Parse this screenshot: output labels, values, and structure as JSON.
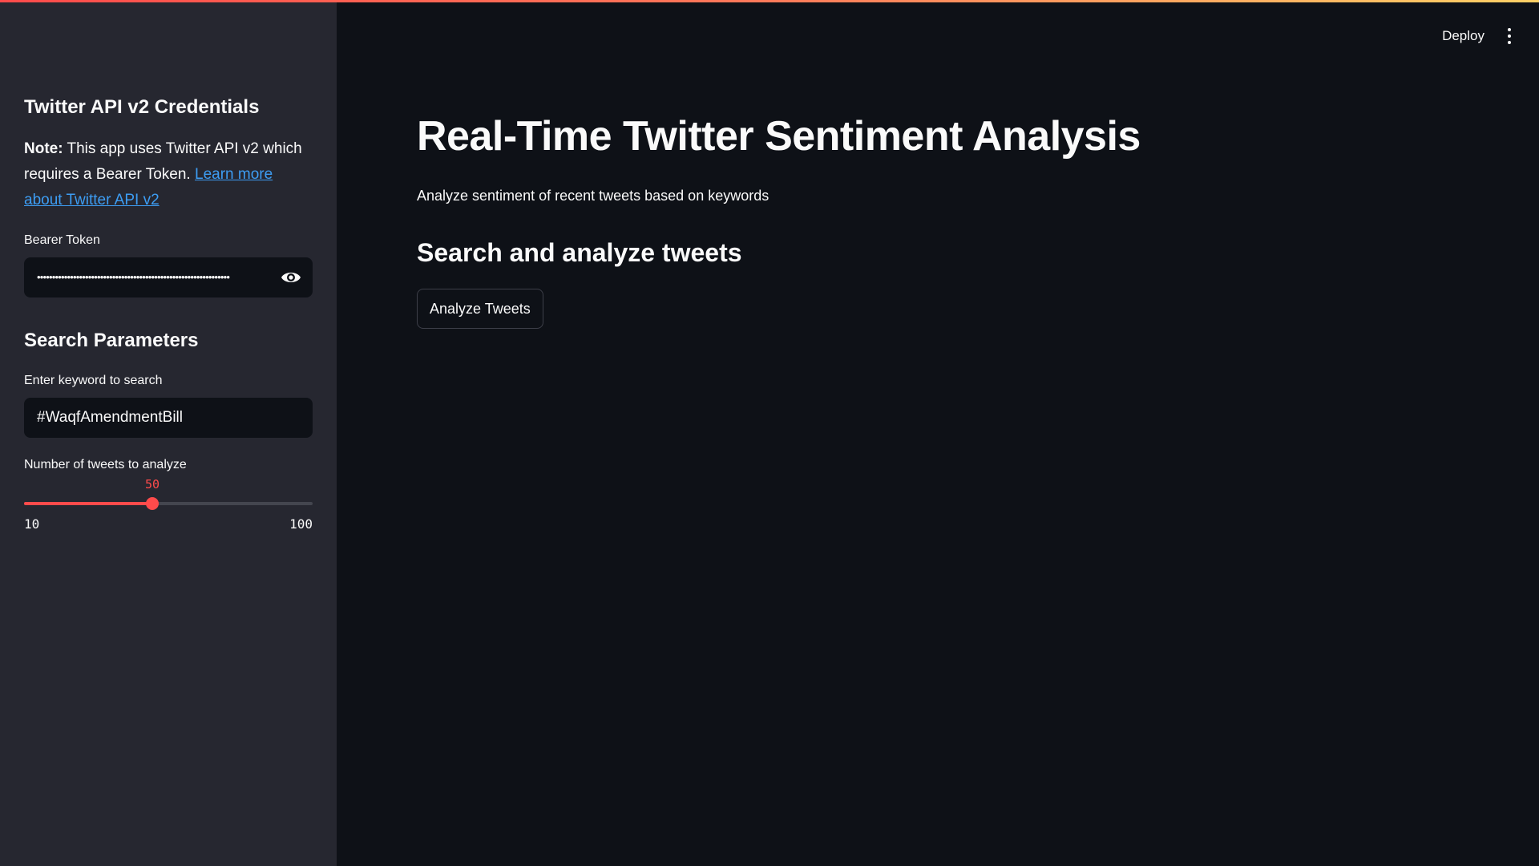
{
  "sidebar": {
    "credentials_heading": "Twitter API v2 Credentials",
    "note": {
      "bold": "Note:",
      "text": " This app uses Twitter API v2 which requires a Bearer Token. ",
      "link": "Learn more about Twitter API v2"
    },
    "bearer_token": {
      "label": "Bearer Token",
      "masked_value": "••••••••••••••••••••••••••••••••••••••••••••••••••••••••••••••••"
    },
    "search_heading": "Search Parameters",
    "keyword": {
      "label": "Enter keyword to search",
      "value": "#WaqfAmendmentBill"
    },
    "tweet_count": {
      "label": "Number of tweets to analyze",
      "value": 50,
      "min": 10,
      "max": 100
    }
  },
  "header": {
    "deploy_label": "Deploy"
  },
  "main": {
    "title": "Real-Time Twitter Sentiment Analysis",
    "subtitle": "Analyze sentiment of recent tweets based on keywords",
    "section_title": "Search and analyze tweets",
    "analyze_button": "Analyze Tweets"
  },
  "colors": {
    "accent": "#ff4b4b",
    "link": "#3d9df3",
    "background": "#0e1117",
    "sidebar": "#262730"
  },
  "icons": {
    "password_toggle": "eye-icon",
    "main_menu": "vertical-dots-icon"
  }
}
